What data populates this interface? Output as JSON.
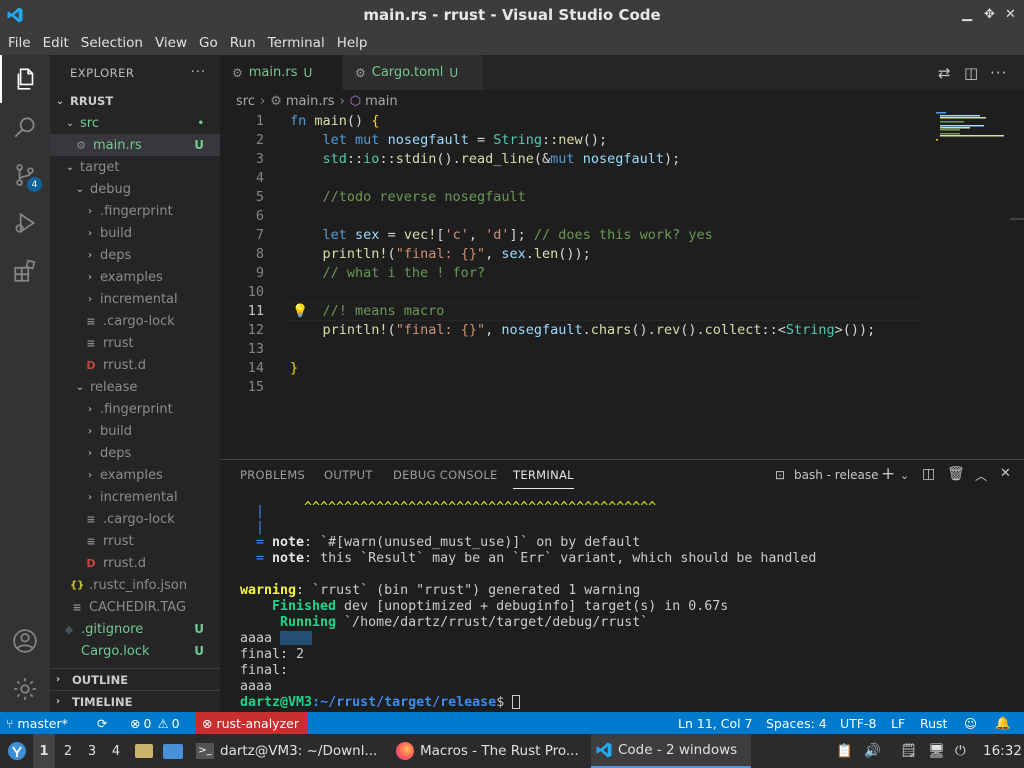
{
  "window": {
    "title": "main.rs - rrust - Visual Studio Code"
  },
  "menu": [
    "File",
    "Edit",
    "Selection",
    "View",
    "Go",
    "Run",
    "Terminal",
    "Help"
  ],
  "activity": {
    "scm_badge": "4"
  },
  "explorer": {
    "header": "EXPLORER",
    "root": "RRUST",
    "items": [
      {
        "label": "src",
        "status": "•"
      },
      {
        "label": "main.rs",
        "status": "U"
      },
      {
        "label": "target",
        "status": ""
      },
      {
        "label": "debug",
        "status": ""
      },
      {
        "label": ".fingerprint",
        "status": ""
      },
      {
        "label": "build",
        "status": ""
      },
      {
        "label": "deps",
        "status": ""
      },
      {
        "label": "examples",
        "status": ""
      },
      {
        "label": "incremental",
        "status": ""
      },
      {
        "label": ".cargo-lock",
        "status": ""
      },
      {
        "label": "rrust",
        "status": ""
      },
      {
        "label": "rrust.d",
        "status": ""
      },
      {
        "label": "release",
        "status": ""
      },
      {
        "label": ".fingerprint",
        "status": ""
      },
      {
        "label": "build",
        "status": ""
      },
      {
        "label": "deps",
        "status": ""
      },
      {
        "label": "examples",
        "status": ""
      },
      {
        "label": "incremental",
        "status": ""
      },
      {
        "label": ".cargo-lock",
        "status": ""
      },
      {
        "label": "rrust",
        "status": ""
      },
      {
        "label": "rrust.d",
        "status": ""
      },
      {
        "label": ".rustc_info.json",
        "status": ""
      },
      {
        "label": "CACHEDIR.TAG",
        "status": ""
      },
      {
        "label": ".gitignore",
        "status": "U"
      },
      {
        "label": "Cargo.lock",
        "status": "U"
      }
    ],
    "outline": "OUTLINE",
    "timeline": "TIMELINE"
  },
  "tabs": [
    {
      "label": "main.rs",
      "status": "U"
    },
    {
      "label": "Cargo.toml",
      "status": "U"
    }
  ],
  "breadcrumb": {
    "folder": "src",
    "file": "main.rs",
    "symbol": "main"
  },
  "editor": {
    "line_numbers": [
      "1",
      "2",
      "3",
      "4",
      "5",
      "6",
      "7",
      "8",
      "9",
      "10",
      "11",
      "12",
      "13",
      "14",
      "15"
    ]
  },
  "panel": {
    "tabs": [
      "PROBLEMS",
      "OUTPUT",
      "DEBUG CONSOLE",
      "TERMINAL"
    ],
    "terminal_name": "bash - release",
    "lines": {
      "carets": "^^^^^^^^^^^^^^^^^^^^^^^^^^^^^^^^^^^^^^^^^^^^",
      "pipe": "|",
      "eq": "=",
      "note": "note",
      "note1_rest": ": `#[warn(unused_must_use)]` on by default",
      "note2_rest": ": this `Result` may be an `Err` variant, which should be handled",
      "warning": "warning",
      "warning_rest": ": `rrust` (bin \"rrust\") generated 1 warning",
      "finished": "Finished",
      "finished_rest": " dev [unoptimized + debuginfo] target(s) in 0.67s",
      "running": "Running",
      "running_rest": " `/home/dartz/rrust/target/debug/rrust`",
      "out1": "aaaa",
      "out2": "final: 2",
      "out3": "final:",
      "out4": "aaaa",
      "prompt_user": "dartz@VM3",
      "prompt_path": ":~/rrust/target/release",
      "prompt_end": "$"
    }
  },
  "status": {
    "branch": "master*",
    "errors": "0",
    "warnings": "0",
    "analyzer": "rust-analyzer",
    "position": "Ln 11, Col 7",
    "spaces": "Spaces: 4",
    "encoding": "UTF-8",
    "eol": "LF",
    "language": "Rust"
  },
  "taskbar": {
    "workspaces": [
      "1",
      "2",
      "3",
      "4"
    ],
    "tasks": [
      "dartz@VM3: ~/Downl...",
      "Macros - The Rust Pro...",
      "Code - 2 windows"
    ],
    "clock": "16:32"
  }
}
